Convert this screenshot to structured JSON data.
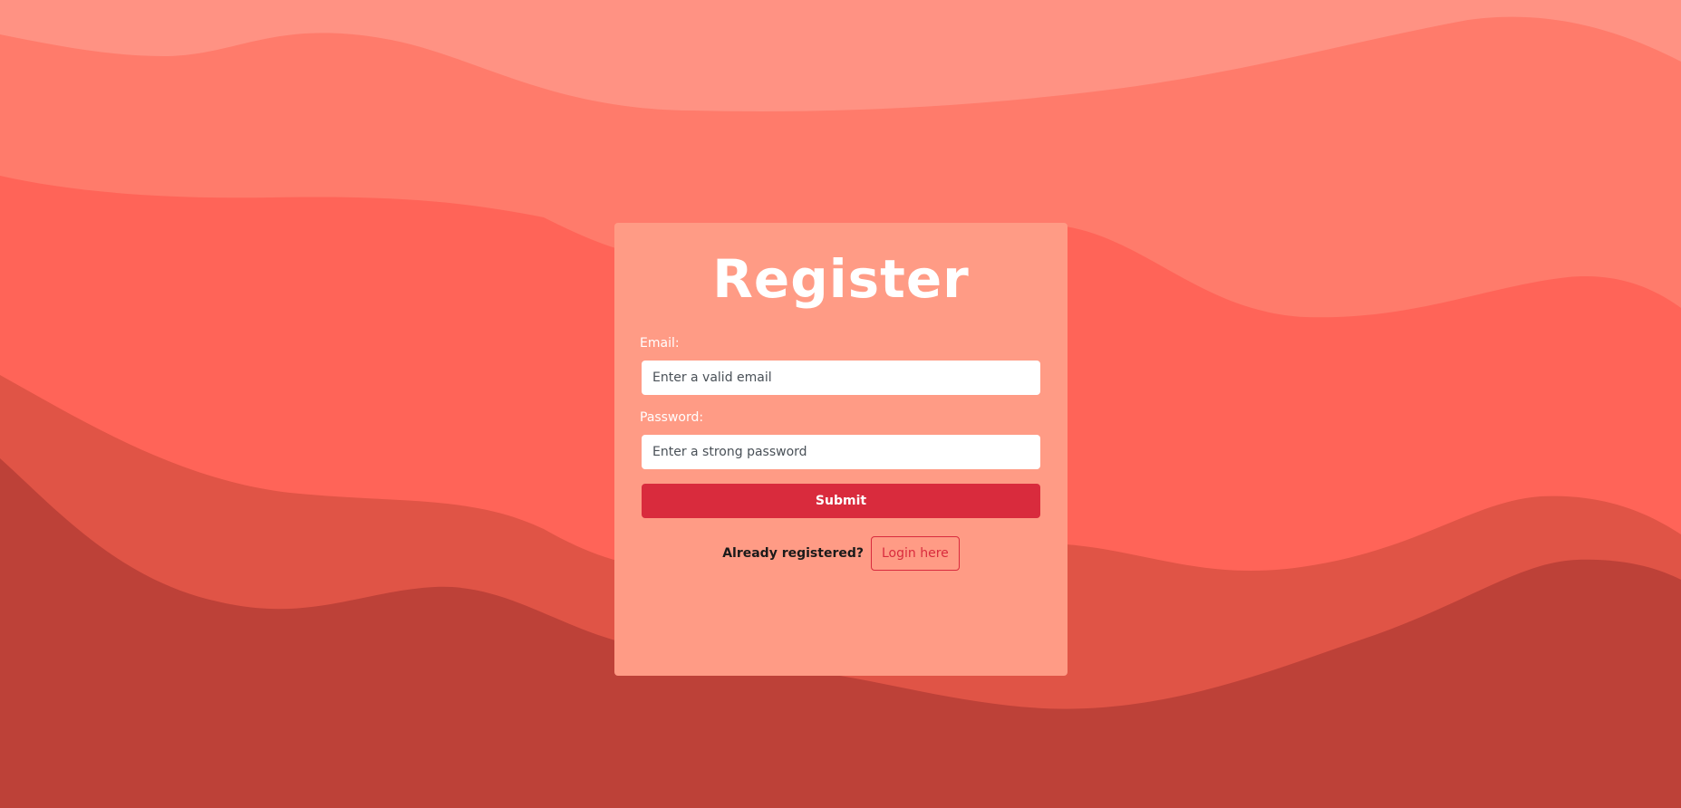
{
  "page": {
    "title": "Register"
  },
  "form": {
    "email_label": "Email:",
    "email_placeholder": "Enter a valid email",
    "email_value": "",
    "password_label": "Password:",
    "password_placeholder": "Enter a strong password",
    "password_value": "",
    "submit_label": "Submit"
  },
  "login": {
    "prompt": "Already registered?",
    "button_label": "Login here"
  },
  "colors": {
    "wave_top": "#ff9283",
    "wave_2": "#ff7b6b",
    "wave_3": "#ff6458",
    "wave_4": "#e05446",
    "wave_bottom": "#bd4138",
    "card": "#ff9b85",
    "submit": "#d92b3d",
    "login_outline": "#d92b3d"
  }
}
